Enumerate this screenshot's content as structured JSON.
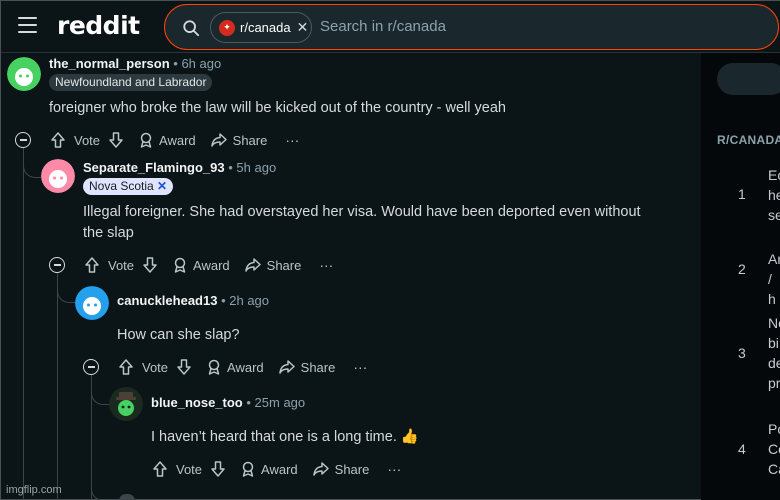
{
  "header": {
    "logo": "reddit",
    "subreddit_chip": "r/canada",
    "search_placeholder": "Search in r/canada"
  },
  "sidebar": {
    "title": "R/CANADA",
    "items": [
      {
        "rank": "1",
        "lines": [
          "Ec",
          "he",
          "se"
        ]
      },
      {
        "rank": "2",
        "lines": [
          "Ar",
          "/ h"
        ]
      },
      {
        "rank": "3",
        "lines": [
          "No",
          "bi",
          "de",
          "pr"
        ]
      },
      {
        "rank": "4",
        "lines": [
          "Po",
          "Co",
          "Ca"
        ]
      }
    ]
  },
  "comments": [
    {
      "username": "the_normal_person",
      "time": "6h ago",
      "flair": "Newfoundland and Labrador",
      "body": [
        "foreigner who broke the law will be kicked out of the country - well yeah"
      ],
      "avatar_color": "#46d160"
    },
    {
      "username": "Separate_Flamingo_93",
      "time": "5h ago",
      "flair": "Nova Scotia",
      "body": [
        "Illegal foreigner. She had overstayed her visa. Would have been deported even without",
        "the slap"
      ],
      "avatar_color": "#ff8aa8"
    },
    {
      "username": "canucklehead13",
      "time": "2h ago",
      "flair": "",
      "body": [
        "How can she slap?"
      ],
      "avatar_color": "#24a0ed"
    },
    {
      "username": "blue_nose_too",
      "time": "25m ago",
      "flair": "",
      "body": [
        "I haven’t heard that one is a long time. 👍"
      ],
      "avatar_color": "#1b2a1e"
    }
  ],
  "actions": {
    "vote": "Vote",
    "award": "Award",
    "share": "Share",
    "more": "···"
  },
  "watermark": "imgflip.com",
  "colors": {
    "background": "#0b1416",
    "search_border": "#ff4500",
    "text_primary": "#d7dadc",
    "text_muted": "#8ba2ad"
  }
}
